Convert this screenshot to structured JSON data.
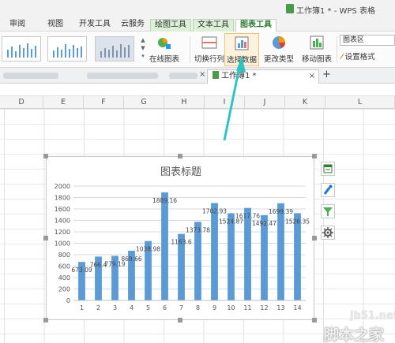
{
  "window": {
    "title": "工作簿1 * - WPS 表格"
  },
  "menu": {
    "tabs": [
      {
        "label": "审阅",
        "type": "normal"
      },
      {
        "label": "视图",
        "type": "normal"
      },
      {
        "label": "开发工具",
        "type": "normal"
      },
      {
        "label": "云服务",
        "type": "normal"
      },
      {
        "label": "绘图工具",
        "type": "context"
      },
      {
        "label": "文本工具",
        "type": "context"
      },
      {
        "label": "图表工具",
        "type": "active"
      }
    ]
  },
  "ribbon": {
    "online_chart": "在线图表",
    "switch_rowcol": "切换行列",
    "select_data": "选择数据",
    "change_type": "更改类型",
    "move_chart": "移动图表",
    "chart_area_dropdown": "图表区",
    "set_format": "设置格式",
    "gallery_up": "▲",
    "gallery_down": "▼",
    "gallery_more": "▾"
  },
  "doc_tabs": {
    "active_label": "工作簿1 *",
    "close_glyph": "×",
    "add_glyph": "+"
  },
  "columns": [
    "D",
    "E",
    "F",
    "G",
    "H",
    "I",
    "J",
    "K",
    "L"
  ],
  "chart_data": {
    "type": "bar",
    "title": "图表标题",
    "categories": [
      "1",
      "2",
      "3",
      "4",
      "5",
      "6",
      "7",
      "8",
      "9",
      "10",
      "11",
      "12",
      "13",
      "14"
    ],
    "values": [
      673.09,
      766.4,
      779.19,
      869.66,
      1038.98,
      1889.16,
      1163.6,
      1373.78,
      1702.93,
      1524.87,
      1617.76,
      1492.47,
      1699.39,
      1526.35
    ],
    "data_labels": [
      "673.09",
      "766.4",
      "779.19",
      "869.66",
      "1038.98",
      "1889.16",
      "1163.6",
      "1373.78",
      "1702.93",
      "1524.87",
      "1617.76",
      "1492.47",
      "1699.39",
      "1526.35"
    ],
    "ylim": [
      0,
      2000
    ],
    "yticks": [
      "0",
      "200",
      "400",
      "600",
      "800",
      "1000",
      "1200",
      "1400",
      "1600",
      "1800",
      "2000"
    ],
    "grid": true,
    "bar_color": "#5b9bd5"
  },
  "watermark": {
    "site": "jb51.net",
    "brand": "脚本之家"
  },
  "colors": {
    "accent_green": "#2e7d32",
    "arrow": "#2fc4c4"
  }
}
